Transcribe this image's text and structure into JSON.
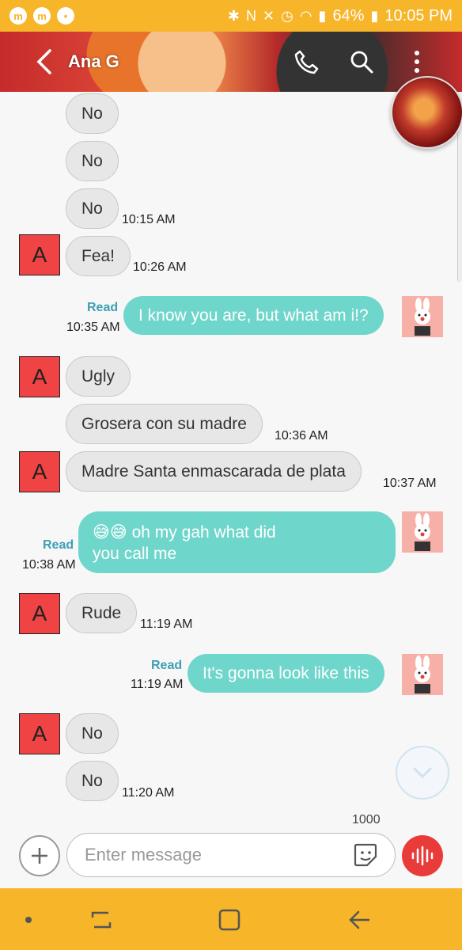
{
  "status_bar": {
    "battery": "64%",
    "time": "10:05 PM"
  },
  "header": {
    "contact_name": "Ana G",
    "back_icon": "back-arrow-icon",
    "call_icon": "phone-icon",
    "search_icon": "search-icon",
    "more_icon": "more-vert-icon"
  },
  "messages": [
    {
      "text": "No"
    },
    {
      "text": "No"
    },
    {
      "text": "No",
      "time": "10:15 AM"
    },
    {
      "avatar": "A",
      "text": "Fea!",
      "time": "10:26 AM"
    },
    {
      "status": "Read",
      "time": "10:35 AM",
      "text": "I know you are, but what am i!?"
    },
    {
      "avatar": "A",
      "text": "Ugly"
    },
    {
      "text": "Grosera con su madre",
      "time": "10:36 AM"
    },
    {
      "avatar": "A",
      "text": "Madre Santa enmascarada de plata",
      "time": "10:37 AM"
    },
    {
      "status": "Read",
      "time": "10:38 AM",
      "line1": "😅😅 oh my gah what did",
      "line2": "you call me"
    },
    {
      "avatar": "A",
      "text": "Rude",
      "time": "11:19 AM"
    },
    {
      "status": "Read",
      "time": "11:19 AM",
      "text": "It's gonna look like this"
    },
    {
      "avatar": "A",
      "text": "No"
    },
    {
      "text": "No",
      "time": "11:20 AM"
    }
  ],
  "composer": {
    "placeholder": "Enter message",
    "char_count": "1000"
  },
  "colors": {
    "accent": "#f7b52a",
    "outgoing_bubble": "#6fd6cc",
    "incoming_bubble": "#e7e7e7",
    "read_label": "#3c9fb5",
    "voice_button": "#ea3b3b",
    "contact_avatar": "#f04444"
  }
}
